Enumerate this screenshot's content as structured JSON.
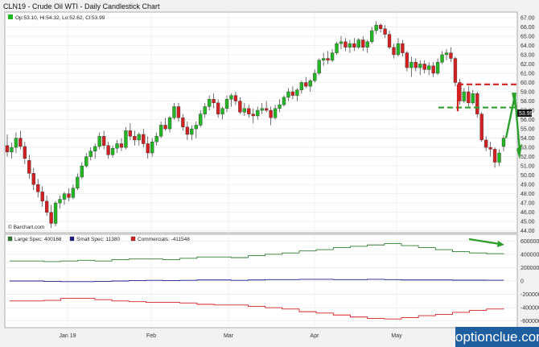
{
  "title": "CLN19 - Crude Oil WTI - Daily Candlestick Chart",
  "ohlc_label": "Op:53.10, Hi:54.32, Lo:52.62, Cl:53.99",
  "last_price_tag": "53.99",
  "credit": "© Barchart.com",
  "watermark": "optionclue.com",
  "colors": {
    "up": "#22b822",
    "down": "#d42020",
    "large": "#2e7d2e",
    "small": "#1b1b8a",
    "comm": "#d42020",
    "annot_green": "#2ca02c",
    "annot_red": "#d42020"
  },
  "chart_data": [
    {
      "type": "candlestick",
      "y_ticks": [
        "44.00",
        "45.00",
        "46.00",
        "47.00",
        "48.00",
        "49.00",
        "50.00",
        "51.00",
        "52.00",
        "53.00",
        "54.00",
        "55.00",
        "56.00",
        "57.00",
        "58.00",
        "59.00",
        "60.00",
        "61.00",
        "62.00",
        "63.00",
        "64.00",
        "65.00",
        "66.00",
        "67.00"
      ],
      "ylim": [
        43.8,
        67.6
      ],
      "x_ticks": [
        "Jan 19",
        "Feb",
        "Mar",
        "Apr",
        "May"
      ],
      "candles": [
        {
          "o": 53.2,
          "h": 54.4,
          "l": 52.0,
          "c": 52.5
        },
        {
          "o": 52.5,
          "h": 53.5,
          "l": 51.8,
          "c": 53.0
        },
        {
          "o": 53.0,
          "h": 54.6,
          "l": 52.4,
          "c": 54.0
        },
        {
          "o": 54.0,
          "h": 54.8,
          "l": 52.8,
          "c": 53.1
        },
        {
          "o": 53.1,
          "h": 53.6,
          "l": 51.2,
          "c": 51.8
        },
        {
          "o": 51.6,
          "h": 52.2,
          "l": 49.6,
          "c": 50.2
        },
        {
          "o": 50.2,
          "h": 50.8,
          "l": 48.4,
          "c": 49.0
        },
        {
          "o": 49.0,
          "h": 49.6,
          "l": 47.6,
          "c": 48.2
        },
        {
          "o": 48.2,
          "h": 48.8,
          "l": 46.6,
          "c": 47.2
        },
        {
          "o": 47.2,
          "h": 47.8,
          "l": 45.6,
          "c": 46.0
        },
        {
          "o": 46.0,
          "h": 46.8,
          "l": 44.3,
          "c": 44.8
        },
        {
          "o": 44.8,
          "h": 47.2,
          "l": 44.5,
          "c": 47.0
        },
        {
          "o": 47.0,
          "h": 47.8,
          "l": 46.4,
          "c": 47.4
        },
        {
          "o": 47.4,
          "h": 48.2,
          "l": 46.8,
          "c": 48.0
        },
        {
          "o": 48.0,
          "h": 48.6,
          "l": 47.2,
          "c": 47.6
        },
        {
          "o": 47.6,
          "h": 49.0,
          "l": 47.4,
          "c": 48.6
        },
        {
          "o": 48.6,
          "h": 50.2,
          "l": 48.4,
          "c": 49.8
        },
        {
          "o": 49.8,
          "h": 51.4,
          "l": 49.6,
          "c": 51.0
        },
        {
          "o": 51.0,
          "h": 52.4,
          "l": 50.8,
          "c": 52.0
        },
        {
          "o": 52.0,
          "h": 53.0,
          "l": 51.6,
          "c": 52.6
        },
        {
          "o": 52.6,
          "h": 53.4,
          "l": 51.8,
          "c": 53.1
        },
        {
          "o": 53.1,
          "h": 54.6,
          "l": 52.8,
          "c": 54.2
        },
        {
          "o": 54.2,
          "h": 54.8,
          "l": 52.8,
          "c": 53.2
        },
        {
          "o": 53.2,
          "h": 53.6,
          "l": 51.8,
          "c": 52.2
        },
        {
          "o": 52.2,
          "h": 53.2,
          "l": 51.9,
          "c": 52.9
        },
        {
          "o": 52.9,
          "h": 53.8,
          "l": 52.4,
          "c": 53.4
        },
        {
          "o": 53.4,
          "h": 54.0,
          "l": 52.6,
          "c": 53.0
        },
        {
          "o": 53.0,
          "h": 55.2,
          "l": 52.8,
          "c": 54.8
        },
        {
          "o": 54.8,
          "h": 55.6,
          "l": 53.8,
          "c": 54.2
        },
        {
          "o": 54.2,
          "h": 54.8,
          "l": 53.2,
          "c": 53.8
        },
        {
          "o": 53.8,
          "h": 54.6,
          "l": 53.2,
          "c": 54.4
        },
        {
          "o": 54.4,
          "h": 55.0,
          "l": 53.0,
          "c": 53.4
        },
        {
          "o": 53.4,
          "h": 54.2,
          "l": 51.8,
          "c": 52.4
        },
        {
          "o": 52.4,
          "h": 54.0,
          "l": 52.0,
          "c": 53.6
        },
        {
          "o": 53.6,
          "h": 54.6,
          "l": 53.2,
          "c": 54.2
        },
        {
          "o": 54.2,
          "h": 55.8,
          "l": 54.0,
          "c": 55.4
        },
        {
          "o": 55.4,
          "h": 56.2,
          "l": 54.8,
          "c": 55.0
        },
        {
          "o": 55.0,
          "h": 56.4,
          "l": 54.6,
          "c": 56.2
        },
        {
          "o": 56.2,
          "h": 57.8,
          "l": 56.0,
          "c": 57.4
        },
        {
          "o": 57.4,
          "h": 57.8,
          "l": 55.8,
          "c": 56.2
        },
        {
          "o": 56.2,
          "h": 56.6,
          "l": 54.8,
          "c": 55.2
        },
        {
          "o": 55.2,
          "h": 55.8,
          "l": 53.8,
          "c": 54.4
        },
        {
          "o": 54.4,
          "h": 55.4,
          "l": 53.8,
          "c": 55.0
        },
        {
          "o": 55.0,
          "h": 55.8,
          "l": 54.0,
          "c": 55.4
        },
        {
          "o": 55.4,
          "h": 57.0,
          "l": 55.2,
          "c": 56.6
        },
        {
          "o": 56.6,
          "h": 57.8,
          "l": 56.2,
          "c": 57.4
        },
        {
          "o": 57.4,
          "h": 58.6,
          "l": 57.0,
          "c": 58.2
        },
        {
          "o": 58.2,
          "h": 58.8,
          "l": 57.2,
          "c": 57.8
        },
        {
          "o": 57.8,
          "h": 58.2,
          "l": 56.2,
          "c": 56.6
        },
        {
          "o": 56.6,
          "h": 57.4,
          "l": 56.0,
          "c": 57.2
        },
        {
          "o": 57.2,
          "h": 58.6,
          "l": 56.8,
          "c": 58.2
        },
        {
          "o": 58.2,
          "h": 58.8,
          "l": 57.4,
          "c": 58.6
        },
        {
          "o": 58.6,
          "h": 59.0,
          "l": 57.6,
          "c": 58.0
        },
        {
          "o": 58.0,
          "h": 58.4,
          "l": 56.6,
          "c": 56.8
        },
        {
          "o": 56.8,
          "h": 57.8,
          "l": 56.4,
          "c": 57.2
        },
        {
          "o": 57.2,
          "h": 57.6,
          "l": 56.2,
          "c": 56.6
        },
        {
          "o": 56.6,
          "h": 57.2,
          "l": 55.6,
          "c": 56.4
        },
        {
          "o": 56.4,
          "h": 57.4,
          "l": 56.0,
          "c": 57.0
        },
        {
          "o": 57.0,
          "h": 57.8,
          "l": 56.6,
          "c": 57.2
        },
        {
          "o": 57.2,
          "h": 58.0,
          "l": 56.8,
          "c": 57.0
        },
        {
          "o": 57.0,
          "h": 57.4,
          "l": 55.4,
          "c": 56.2
        },
        {
          "o": 56.2,
          "h": 57.6,
          "l": 56.0,
          "c": 57.2
        },
        {
          "o": 57.2,
          "h": 58.2,
          "l": 56.8,
          "c": 57.6
        },
        {
          "o": 57.6,
          "h": 58.6,
          "l": 57.4,
          "c": 58.4
        },
        {
          "o": 58.4,
          "h": 59.4,
          "l": 58.0,
          "c": 59.0
        },
        {
          "o": 59.0,
          "h": 59.6,
          "l": 58.2,
          "c": 58.6
        },
        {
          "o": 58.6,
          "h": 59.4,
          "l": 58.0,
          "c": 59.2
        },
        {
          "o": 59.2,
          "h": 60.2,
          "l": 58.8,
          "c": 60.0
        },
        {
          "o": 60.0,
          "h": 60.6,
          "l": 59.4,
          "c": 59.6
        },
        {
          "o": 59.6,
          "h": 60.4,
          "l": 59.0,
          "c": 60.2
        },
        {
          "o": 60.2,
          "h": 61.4,
          "l": 60.0,
          "c": 61.0
        },
        {
          "o": 61.0,
          "h": 62.6,
          "l": 60.8,
          "c": 62.4
        },
        {
          "o": 62.4,
          "h": 63.2,
          "l": 61.8,
          "c": 62.6
        },
        {
          "o": 62.6,
          "h": 63.4,
          "l": 62.0,
          "c": 62.4
        },
        {
          "o": 62.4,
          "h": 63.6,
          "l": 62.2,
          "c": 63.2
        },
        {
          "o": 63.2,
          "h": 64.4,
          "l": 63.0,
          "c": 64.2
        },
        {
          "o": 64.2,
          "h": 65.0,
          "l": 63.6,
          "c": 64.4
        },
        {
          "o": 64.4,
          "h": 64.8,
          "l": 63.4,
          "c": 63.8
        },
        {
          "o": 63.8,
          "h": 64.6,
          "l": 63.2,
          "c": 64.2
        },
        {
          "o": 64.2,
          "h": 64.8,
          "l": 63.4,
          "c": 63.8
        },
        {
          "o": 63.8,
          "h": 64.8,
          "l": 63.6,
          "c": 64.6
        },
        {
          "o": 64.6,
          "h": 65.0,
          "l": 63.4,
          "c": 63.8
        },
        {
          "o": 63.8,
          "h": 64.6,
          "l": 63.2,
          "c": 64.4
        },
        {
          "o": 64.4,
          "h": 66.0,
          "l": 64.2,
          "c": 65.6
        },
        {
          "o": 65.6,
          "h": 66.6,
          "l": 65.2,
          "c": 66.2
        },
        {
          "o": 66.2,
          "h": 66.4,
          "l": 65.4,
          "c": 65.8
        },
        {
          "o": 65.8,
          "h": 66.2,
          "l": 64.8,
          "c": 65.2
        },
        {
          "o": 65.2,
          "h": 65.6,
          "l": 63.6,
          "c": 63.8
        },
        {
          "o": 63.8,
          "h": 64.2,
          "l": 62.6,
          "c": 63.0
        },
        {
          "o": 63.0,
          "h": 64.8,
          "l": 62.8,
          "c": 64.2
        },
        {
          "o": 64.2,
          "h": 64.6,
          "l": 62.8,
          "c": 63.2
        },
        {
          "o": 63.2,
          "h": 63.4,
          "l": 61.2,
          "c": 61.6
        },
        {
          "o": 61.6,
          "h": 62.8,
          "l": 60.6,
          "c": 62.2
        },
        {
          "o": 62.2,
          "h": 62.6,
          "l": 61.2,
          "c": 61.6
        },
        {
          "o": 61.6,
          "h": 62.4,
          "l": 60.8,
          "c": 62.0
        },
        {
          "o": 62.0,
          "h": 62.4,
          "l": 61.0,
          "c": 61.4
        },
        {
          "o": 61.4,
          "h": 62.2,
          "l": 60.8,
          "c": 61.8
        },
        {
          "o": 61.8,
          "h": 62.2,
          "l": 60.6,
          "c": 61.0
        },
        {
          "o": 61.0,
          "h": 62.6,
          "l": 60.8,
          "c": 62.2
        },
        {
          "o": 62.2,
          "h": 63.4,
          "l": 62.0,
          "c": 63.0
        },
        {
          "o": 63.0,
          "h": 63.6,
          "l": 62.4,
          "c": 63.2
        },
        {
          "o": 63.2,
          "h": 63.8,
          "l": 62.2,
          "c": 62.6
        },
        {
          "o": 62.6,
          "h": 62.8,
          "l": 59.6,
          "c": 60.0
        },
        {
          "o": 60.0,
          "h": 60.4,
          "l": 57.6,
          "c": 58.0
        },
        {
          "o": 58.0,
          "h": 59.4,
          "l": 57.8,
          "c": 59.0
        },
        {
          "o": 59.0,
          "h": 59.6,
          "l": 57.4,
          "c": 57.8
        },
        {
          "o": 57.8,
          "h": 59.2,
          "l": 57.6,
          "c": 58.8
        },
        {
          "o": 58.8,
          "h": 59.0,
          "l": 56.2,
          "c": 56.6
        },
        {
          "o": 56.6,
          "h": 56.8,
          "l": 53.6,
          "c": 53.8
        },
        {
          "o": 53.8,
          "h": 54.2,
          "l": 52.6,
          "c": 53.0
        },
        {
          "o": 53.0,
          "h": 53.6,
          "l": 52.0,
          "c": 52.8
        },
        {
          "o": 52.8,
          "h": 53.0,
          "l": 50.8,
          "c": 51.4
        },
        {
          "o": 51.4,
          "h": 52.8,
          "l": 51.0,
          "c": 52.4
        },
        {
          "o": 53.1,
          "h": 54.3,
          "l": 52.6,
          "c": 54.0
        }
      ]
    },
    {
      "type": "line",
      "title": "",
      "legend": [
        "Large Spec: 400168",
        "Small Spec: 11380",
        "Commercials: -411548"
      ],
      "y_ticks": [
        "600000",
        "400000",
        "200000",
        "0",
        "-200000",
        "-400000",
        "-600000"
      ],
      "ylim": [
        -700000,
        700000
      ],
      "x_ticks": [
        "Jan 19",
        "Feb",
        "Mar",
        "Apr",
        "May"
      ],
      "series": [
        {
          "name": "Large Spec",
          "values": [
            300000,
            300000,
            290000,
            300000,
            310000,
            300000,
            320000,
            330000,
            330000,
            320000,
            340000,
            360000,
            360000,
            350000,
            380000,
            400000,
            420000,
            450000,
            470000,
            500000,
            520000,
            540000,
            560000,
            530000,
            500000,
            470000,
            440000,
            420000,
            410000,
            400168
          ]
        },
        {
          "name": "Small Spec",
          "values": [
            0,
            0,
            -5000,
            -10000,
            -10000,
            -5000,
            0,
            5000,
            10000,
            5000,
            10000,
            15000,
            15000,
            10000,
            15000,
            20000,
            20000,
            25000,
            25000,
            20000,
            20000,
            25000,
            20000,
            15000,
            15000,
            15000,
            12000,
            12000,
            11000,
            11380
          ]
        },
        {
          "name": "Commercials",
          "values": [
            -300000,
            -300000,
            -290000,
            -260000,
            -260000,
            -280000,
            -300000,
            -310000,
            -320000,
            -320000,
            -330000,
            -350000,
            -360000,
            -360000,
            -380000,
            -400000,
            -420000,
            -460000,
            -480000,
            -510000,
            -540000,
            -560000,
            -570000,
            -550000,
            -520000,
            -500000,
            -470000,
            -440000,
            -420000,
            -411548
          ]
        }
      ]
    }
  ]
}
